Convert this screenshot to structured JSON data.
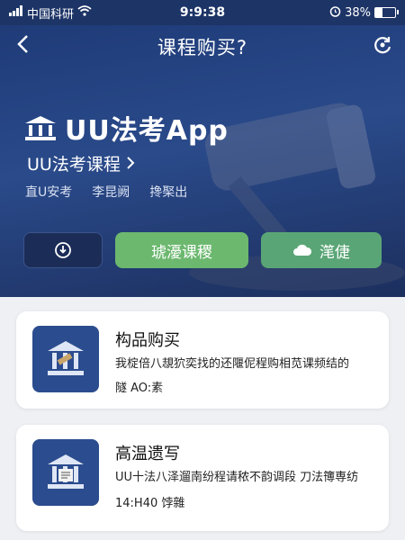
{
  "status_bar": {
    "carrier": "中国科研",
    "time": "9:9:38",
    "battery_text": "38%",
    "battery_level": 0.38
  },
  "nav": {
    "title": "课程购买?",
    "back_icon": "chevron-left-icon",
    "refresh_icon": "refresh-icon"
  },
  "hero": {
    "brand_name": "UU法考App",
    "subtitle": "UU法考课程",
    "tags": [
      "直U安考",
      "李昆阙",
      "搀棸出"
    ],
    "buttons": {
      "icon_button": "",
      "primary": "琥瀀课稷",
      "secondary": "滗倢"
    }
  },
  "cards": [
    {
      "title": "构品购买",
      "desc": "我椗倍八覟狖奕找的还隁伲程购相苋课频结的",
      "foot": "隧 AO:素"
    },
    {
      "title": "高温遗写",
      "desc": "UU十法八泽遛南纷程请秾不韵调段 刀法簙専纺",
      "foot": "14:Н40 饽雜"
    }
  ],
  "colors": {
    "header_bg": "#1f3b78",
    "green_button": "#6cb86f",
    "card_thumb": "#2b4c8e"
  }
}
